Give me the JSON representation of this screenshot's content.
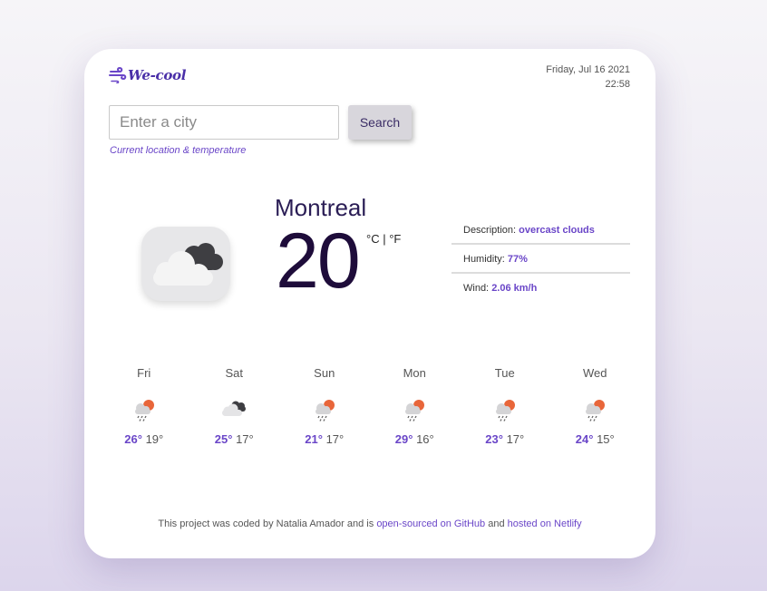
{
  "app": {
    "logo_text": "We-cool"
  },
  "datetime": {
    "date": "Friday, Jul 16 2021",
    "time": "22:58"
  },
  "search": {
    "placeholder": "Enter a city",
    "button_label": "Search",
    "current_location_label": "Current location & temperature"
  },
  "current": {
    "city": "Montreal",
    "temperature": "20",
    "unit_c": "°C",
    "unit_separator": "|",
    "unit_f": "°F",
    "icon": "broken-clouds-icon",
    "description_label": "Description:",
    "description_value": "overcast clouds",
    "humidity_label": "Humidity:",
    "humidity_value": "77%",
    "wind_label": "Wind:",
    "wind_value": "2.06 km/h"
  },
  "forecast": [
    {
      "day": "Fri",
      "icon": "rain-sun-icon",
      "max": "26°",
      "min": "19°"
    },
    {
      "day": "Sat",
      "icon": "broken-clouds-icon",
      "max": "25°",
      "min": "17°"
    },
    {
      "day": "Sun",
      "icon": "rain-sun-icon",
      "max": "21°",
      "min": "17°"
    },
    {
      "day": "Mon",
      "icon": "rain-sun-icon",
      "max": "29°",
      "min": "16°"
    },
    {
      "day": "Tue",
      "icon": "rain-sun-icon",
      "max": "23°",
      "min": "17°"
    },
    {
      "day": "Wed",
      "icon": "rain-sun-icon",
      "max": "24°",
      "min": "15°"
    }
  ],
  "footer": {
    "text_before": "This project was coded by Natalia Amador and is ",
    "link_github": "open-sourced on GitHub",
    "text_middle": " and ",
    "link_netlify": "hosted on Netlify"
  },
  "colors": {
    "accent": "#6a46c8",
    "brand": "#4a2fa8",
    "temperature": "#1e0c3a",
    "sun": "#e8663a"
  }
}
